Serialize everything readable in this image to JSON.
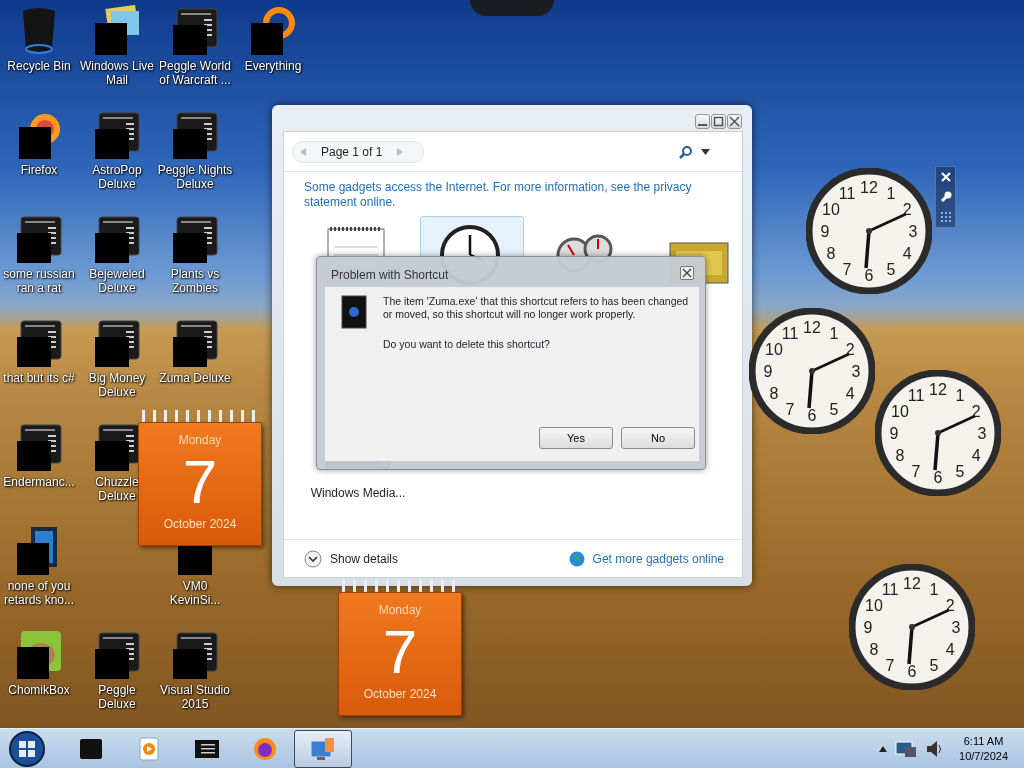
{
  "desktop": {
    "icon_columns": [
      [
        {
          "kind": "bin",
          "label": "Recycle Bin"
        },
        {
          "kind": "firefox",
          "label": "Firefox"
        },
        {
          "kind": "app",
          "label": "some russian ran a rat"
        },
        {
          "kind": "app",
          "label": "that but its c#"
        },
        {
          "kind": "app",
          "label": "Endermanc..."
        },
        {
          "kind": "blue",
          "label": "none of you retards kno..."
        },
        {
          "kind": "hamster",
          "label": "ChomikBox"
        }
      ],
      [
        {
          "kind": "mail",
          "label": "Windows Live Mail"
        },
        {
          "kind": "app",
          "label": "AstroPop Deluxe"
        },
        {
          "kind": "app",
          "label": "Bejeweled Deluxe"
        },
        {
          "kind": "app",
          "label": "Big Money Deluxe"
        },
        {
          "kind": "app",
          "label": "Chuzzle Deluxe"
        },
        null,
        {
          "kind": "app",
          "label": "Peggle Deluxe"
        }
      ],
      [
        {
          "kind": "app",
          "label": "Peggle World of Warcraft ..."
        },
        {
          "kind": "app",
          "label": "Peggle Nights Deluxe"
        },
        {
          "kind": "app",
          "label": "Plants vs Zombies"
        },
        {
          "kind": "app",
          "label": "Zuma Deluxe"
        },
        null,
        {
          "kind": "black",
          "label": "VM0 KevinSi..."
        },
        {
          "kind": "app",
          "label": "Visual Studio 2015"
        }
      ],
      [
        {
          "kind": "ring",
          "label": "Everything"
        }
      ]
    ]
  },
  "calendar_gadgets": [
    {
      "day": "Monday",
      "date": "7",
      "month": "October 2024"
    },
    {
      "day": "Monday",
      "date": "7",
      "month": "October 2024"
    }
  ],
  "gadget_window": {
    "page_label": "Page 1 of 1",
    "info_text": "Some gadgets access the Internet.  For more information, see the privacy statement online.",
    "gadgets": [
      {
        "kind": "calendar",
        "selected": false
      },
      {
        "kind": "clock",
        "selected": true
      },
      {
        "kind": "meter",
        "selected": false
      },
      {
        "kind": "picture",
        "selected": false
      },
      {
        "kind": "media",
        "selected": false,
        "label": "Windows Media..."
      }
    ],
    "show_details": "Show details",
    "more_link": "Get more gadgets online"
  },
  "dialog": {
    "title": "Problem with Shortcut",
    "message": "The item 'Zuma.exe' that this shortcut refers to has been changed or moved, so this shortcut will no longer work properly.",
    "question": "Do you want to delete this shortcut?",
    "buttons": [
      "Yes",
      "No"
    ]
  },
  "clock_gadgets": [
    {
      "numerals": [
        "12",
        "11",
        "1",
        "10",
        "2",
        "9",
        "3",
        "8",
        "4",
        "7",
        "5",
        "6"
      ]
    },
    {
      "numerals": [
        "12",
        "11",
        "1",
        "10",
        "2",
        "9",
        "3",
        "8",
        "4",
        "7",
        "5",
        "6"
      ]
    },
    {
      "numerals": [
        "12",
        "11",
        "1",
        "10",
        "2",
        "9",
        "3",
        "8",
        "4",
        "7",
        "5",
        "6"
      ]
    },
    {
      "numerals": [
        "12",
        "11",
        "1",
        "10",
        "2",
        "9",
        "3",
        "8",
        "4",
        "7",
        "5",
        "6"
      ]
    }
  ],
  "taskbar": {
    "apps": [
      {
        "kind": "black",
        "selected": false
      },
      {
        "kind": "media",
        "selected": false
      },
      {
        "kind": "console",
        "selected": false
      },
      {
        "kind": "firefox",
        "selected": false
      },
      {
        "kind": "gadgets",
        "selected": true
      }
    ],
    "time": "6:11 AM",
    "date": "10/7/2024"
  }
}
